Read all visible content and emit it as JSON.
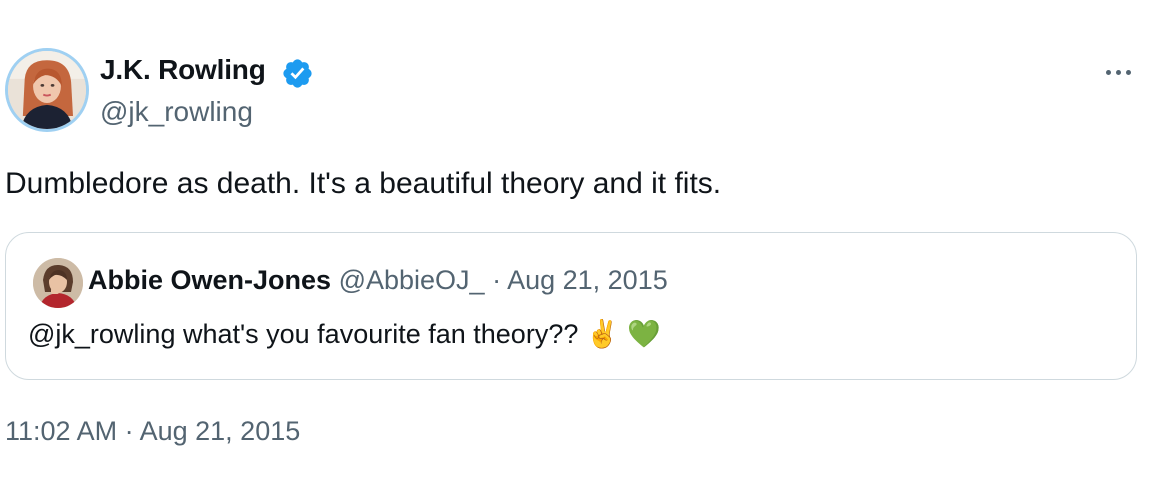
{
  "author": {
    "name": "J.K. Rowling",
    "handle": "@jk_rowling",
    "verified": true,
    "avatar_icon": "profile-photo"
  },
  "more_icon": "more-horizontal-icon",
  "tweet": {
    "text": "Dumbledore as death. It's a beautiful theory and it fits."
  },
  "quote": {
    "name": "Abbie Owen-Jones",
    "handle": "@AbbieOJ_",
    "separator": "·",
    "date": "Aug 21, 2015",
    "text": "@jk_rowling what's you favourite fan theory??",
    "emoji": [
      "✌️",
      "💚"
    ]
  },
  "footer": {
    "time": "11:02 AM",
    "separator": "·",
    "date": "Aug 21, 2015"
  },
  "colors": {
    "text_primary": "#0f1419",
    "text_secondary": "#536471",
    "verified_blue": "#1d9bf0",
    "border": "#cfd9de",
    "avatar_ring": "#9fd0f2"
  }
}
